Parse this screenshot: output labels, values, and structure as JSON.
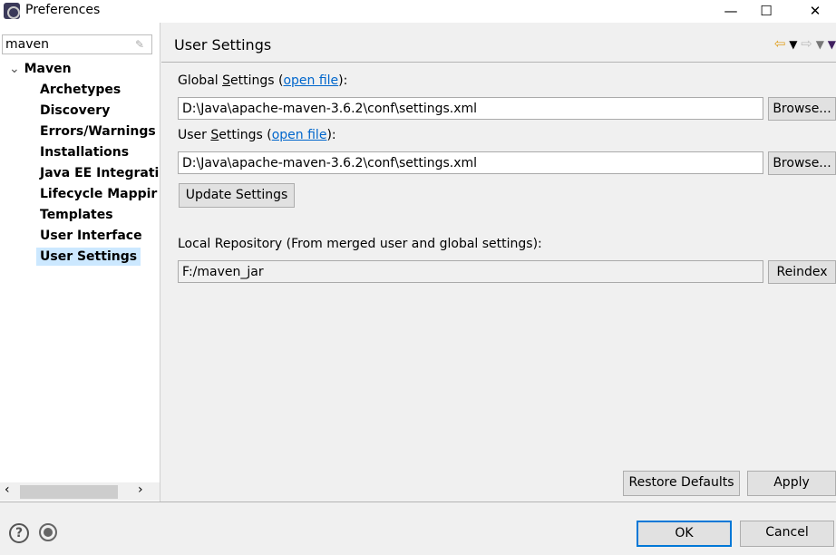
{
  "window": {
    "title": "Preferences",
    "minimize": "—",
    "maximize": "☐",
    "close": "✕"
  },
  "sidebar": {
    "search_value": "maven",
    "root": "Maven",
    "items": [
      {
        "label": "Archetypes"
      },
      {
        "label": "Discovery"
      },
      {
        "label": "Errors/Warnings"
      },
      {
        "label": "Installations"
      },
      {
        "label": "Java EE Integrati"
      },
      {
        "label": "Lifecycle Mappir"
      },
      {
        "label": "Templates"
      },
      {
        "label": "User Interface"
      },
      {
        "label": "User Settings",
        "selected": true
      }
    ]
  },
  "page": {
    "title": "User Settings",
    "global_label_pre": "Global ",
    "global_label_u": "S",
    "global_label_post": "ettings (",
    "open_file": "open file",
    "label_end": "):",
    "global_value": "D:\\Java\\apache-maven-3.6.2\\conf\\settings.xml",
    "user_label_pre": "User ",
    "user_label_u": "S",
    "user_label_post": "ettings (",
    "user_value": "D:\\Java\\apache-maven-3.6.2\\conf\\settings.xml",
    "browse": "Browse...",
    "update": "Update Settings",
    "local_label": "Local Repository (From merged user and global settings):",
    "local_value": "F:/maven_jar",
    "reindex": "Reindex",
    "restore": "Restore Defaults",
    "apply": "Apply"
  },
  "footer": {
    "ok": "OK",
    "cancel": "Cancel"
  }
}
